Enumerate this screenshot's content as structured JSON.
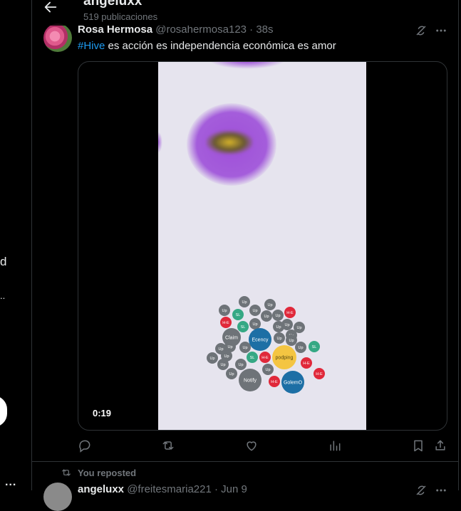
{
  "header": {
    "title": "angeluxx",
    "post_count": "519 publicaciones"
  },
  "left_rail": {
    "fragment_1": "d",
    "fragment_2": "..",
    "more": "..."
  },
  "tweet": {
    "author_name": "Rosa Hermosa",
    "author_handle": "@rosahermosa123 · 38s",
    "hashtag": "#Hive",
    "text": " es acción es independencia económica es amor",
    "video": {
      "duration": "0:19",
      "bubbles": [
        "Up",
        "Up",
        "Up",
        "Up",
        "SL",
        "Up",
        "Up",
        "Up",
        "H-E",
        "H-E",
        "SL",
        "Up",
        "Up",
        "Up",
        "Up",
        "Claim",
        "Ecency",
        "Up",
        "Up",
        "Up",
        "SL",
        "Up",
        "Up",
        "Up",
        "Up",
        "SL",
        "H-E",
        "podping",
        "Up",
        "Up",
        "Up",
        "H-E",
        "Up",
        "Up",
        "H-E",
        "Notify",
        "H-E",
        "GolemO"
      ]
    },
    "actions": [
      "reply-icon",
      "repost-icon",
      "like-icon",
      "views-icon",
      "bookmark-icon",
      "share-icon"
    ]
  },
  "next_item": {
    "repost_label": "You reposted",
    "author_name": "angeluxx",
    "author_handle": "@freitesmaria221 · Jun 9"
  },
  "colors": {
    "background": "#000000",
    "text": "#e7e9ea",
    "muted": "#71767b",
    "accent": "#1d9bf0",
    "border": "#2f3336",
    "bubble_gray": "#6e7378",
    "bubble_red": "#e0283a",
    "bubble_green": "#35a884",
    "bubble_blue": "#1d6fa5",
    "bubble_yellow": "#f4c542"
  }
}
